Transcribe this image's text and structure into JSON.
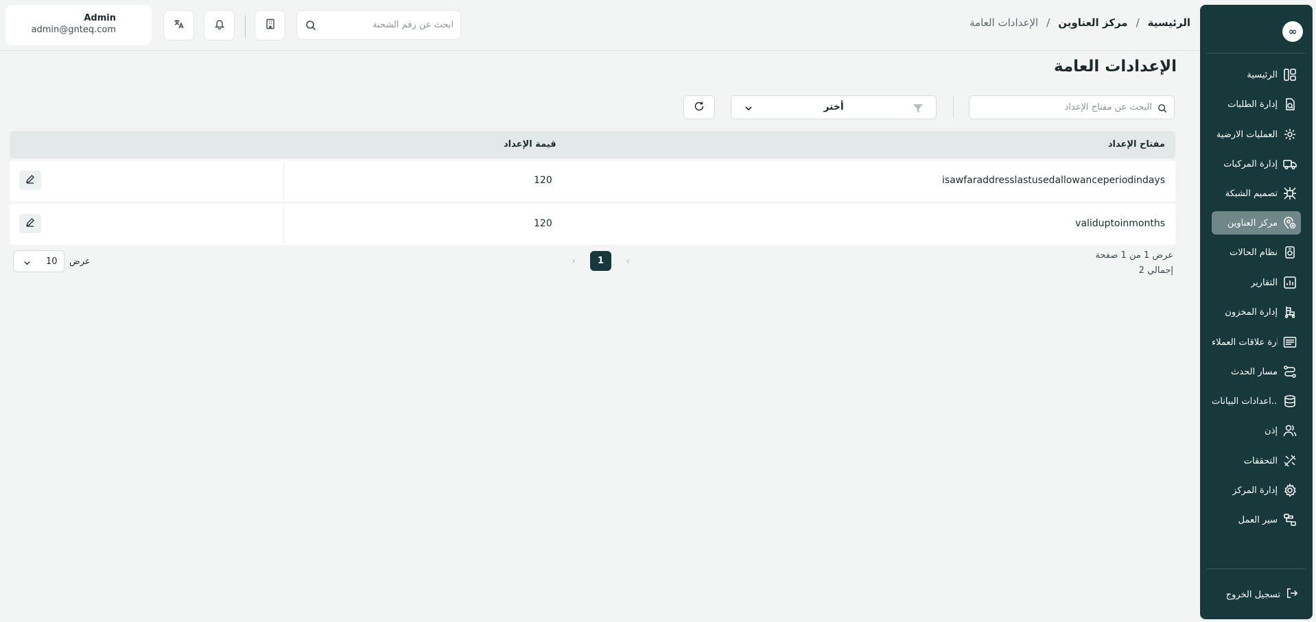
{
  "sidebar": {
    "logo": "∞",
    "items": [
      {
        "label": "الرئيسية",
        "icon": "layout-icon"
      },
      {
        "label": "إدارة الطلبات",
        "icon": "orders-icon"
      },
      {
        "label": "العمليات الارضية",
        "icon": "operations-icon"
      },
      {
        "label": "إدارة المركبات",
        "icon": "truck-icon"
      },
      {
        "label": "تصميم الشبكة",
        "icon": "network-icon"
      },
      {
        "label": "مركز العناوين",
        "icon": "address-icon"
      },
      {
        "label": "نظام الحالات",
        "icon": "status-icon"
      },
      {
        "label": "التقارير",
        "icon": "reports-icon"
      },
      {
        "label": "إدارة المخزون",
        "icon": "inventory-icon"
      },
      {
        "label": "إدارة علاقات العملاء",
        "icon": "crm-icon"
      },
      {
        "label": "مسار الحدث",
        "icon": "route-icon"
      },
      {
        "label": "اعدادات البيانات...",
        "icon": "database-icon"
      },
      {
        "label": "إذن",
        "icon": "users-icon"
      },
      {
        "label": "التحققات",
        "icon": "tools-icon"
      },
      {
        "label": "إدارة المركز",
        "icon": "center-gear-icon"
      },
      {
        "label": "سير العمل",
        "icon": "workflow-icon"
      }
    ],
    "active_index": 5,
    "logout": "تسجيل الخروج"
  },
  "breadcrumb": {
    "home": "الرئيسية",
    "section": "مركز العناوين",
    "current": "الإعدادات العامة",
    "separator": "/"
  },
  "header": {
    "search_placeholder": "ابحث عن رقم الشحنة",
    "user_name": "Admin",
    "user_email": "admin@gnteq.com"
  },
  "page": {
    "title": "الإعدادات العامة",
    "key_search_placeholder": "البحث عن مفتاح الإعداد",
    "filter_value": "أختر"
  },
  "table": {
    "headers": {
      "key": "مفتاح الإعداد",
      "value": "قيمة الإعداد"
    },
    "rows": [
      {
        "key": "isawfaraddresslastusedallowanceperiodindays",
        "value": "120"
      },
      {
        "key": "validuptoinmonths",
        "value": "120"
      }
    ]
  },
  "pagination": {
    "page_info": "عرض 1 من 1 صفحة",
    "total": "إجمالي 2",
    "current_page": "1",
    "prev_arrow": "‹",
    "next_arrow": "›",
    "per_page_label": "عرض",
    "per_page_value": "10"
  },
  "colors": {
    "sidebar_bg": "#18393b",
    "active_item": "#6f8789",
    "page_bg": "#f3f5f5",
    "table_header": "#e3e8e8"
  }
}
